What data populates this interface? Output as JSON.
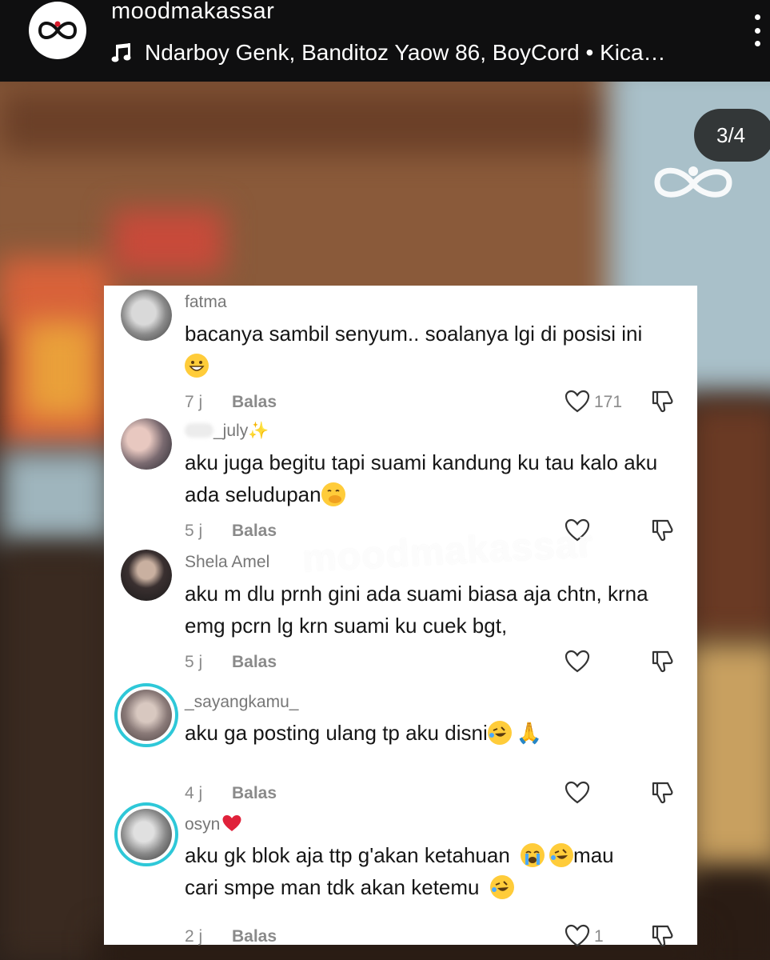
{
  "header": {
    "account_name": "moodmakassar",
    "music_text": "Ndarboy Genk, Banditoz Yaow 86, BoyCord • Kica…"
  },
  "page_counter": "3/4",
  "watermark_text": "moodmakassar",
  "comments": [
    {
      "username": "fatma",
      "text": "bacanya sambil senyum.. soalanya lgi di posisi ini",
      "time": "7 j",
      "reply": "Balas",
      "likes": "171",
      "emojis": [
        "grinning"
      ]
    },
    {
      "username": "_july",
      "text": "aku juga begitu tapi suami kandung ku tau kalo aku ada seludupan",
      "time": "5 j",
      "reply": "Balas",
      "likes": "",
      "emojis": [
        "sparkles",
        "face-with-hand-over-mouth"
      ]
    },
    {
      "username": "Shela Amel",
      "text": "aku m dlu prnh gini ada suami biasa aja chtn, krna emg pcrn lg krn suami ku cuek bgt,",
      "time": "5 j",
      "reply": "Balas",
      "likes": "",
      "emojis": []
    },
    {
      "username": "_sayangkamu_",
      "text": "aku ga posting ulang tp aku disni",
      "time": "4 j",
      "reply": "Balas",
      "likes": "",
      "emojis": [
        "rofl",
        "folded-hands"
      ]
    },
    {
      "username": "osyn",
      "text_part1": "aku gk blok aja ttp g'akan ketahuan",
      "text_part2": "mau",
      "text_part3": "cari smpe man tdk akan ketemu",
      "time": "2 j",
      "reply": "Balas",
      "likes": "1",
      "emojis": [
        "red-heart",
        "crying",
        "rofl",
        "rofl"
      ]
    }
  ],
  "colors": {
    "header_bg": "#0f0f10",
    "story_ring": "#2ec8d8",
    "heart_red": "#e0213a"
  }
}
